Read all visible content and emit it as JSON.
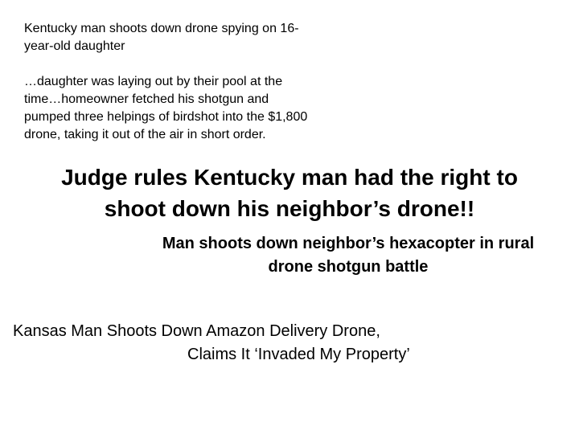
{
  "slide": {
    "story1": {
      "headline_lines": [
        "Kentucky man shoots down drone spying on 16-",
        "year-old daughter"
      ],
      "excerpt_lines": [
        "…daughter was laying out by their pool at the",
        "time…homeowner fetched his shotgun and",
        "pumped three helpings of birdshot into the $1,800",
        "drone, taking it out of the air in short order."
      ]
    },
    "main_headline_lines": [
      "Judge rules Kentucky man had the right to",
      "shoot down his neighbor’s drone!!"
    ],
    "sub_headline_lines": [
      "Man shoots down neighbor’s hexacopter in rural",
      "drone shotgun battle"
    ],
    "kansas_headline_lines": [
      "Kansas Man Shoots Down Amazon Delivery Drone,",
      "Claims It ‘Invaded My Property’"
    ]
  }
}
